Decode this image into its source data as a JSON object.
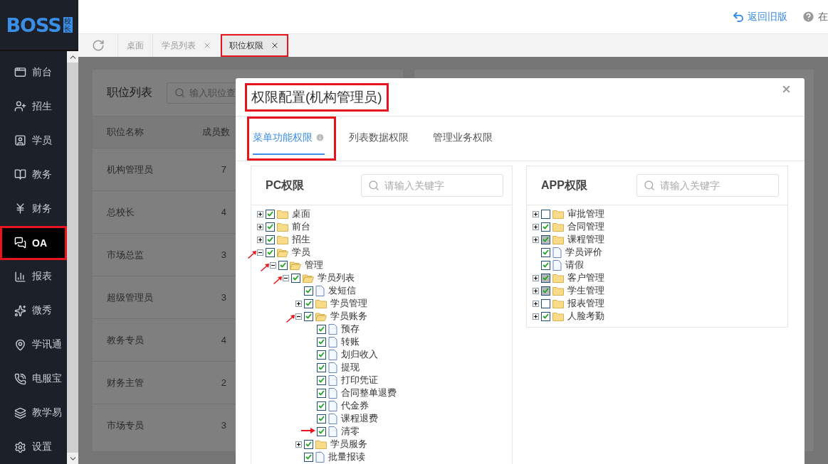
{
  "logo": {
    "text": "BOSS",
    "badge": "校长"
  },
  "header": {
    "links": [
      {
        "kind": "undo",
        "label": "返回旧版"
      },
      {
        "kind": "help",
        "label": "在"
      }
    ]
  },
  "tabs": [
    {
      "label": "桌面",
      "closable": false,
      "selected": false,
      "highlighted": false
    },
    {
      "label": "学员列表",
      "closable": true,
      "selected": false,
      "highlighted": false
    },
    {
      "label": "职位权限",
      "closable": true,
      "selected": true,
      "highlighted": true
    }
  ],
  "sidebar": {
    "items": [
      {
        "label": "前台",
        "selected": false,
        "highlighted": false
      },
      {
        "label": "招生",
        "selected": false,
        "highlighted": false
      },
      {
        "label": "学员",
        "selected": false,
        "highlighted": false
      },
      {
        "label": "教务",
        "selected": false,
        "highlighted": false
      },
      {
        "label": "财务",
        "selected": false,
        "highlighted": false
      },
      {
        "label": "OA",
        "selected": true,
        "highlighted": true
      },
      {
        "label": "报表",
        "selected": false,
        "highlighted": false
      },
      {
        "label": "微秀",
        "selected": false,
        "highlighted": false
      },
      {
        "label": "学讯通",
        "selected": false,
        "highlighted": false
      },
      {
        "label": "电服宝",
        "selected": false,
        "highlighted": false
      },
      {
        "label": "教学易",
        "selected": false,
        "highlighted": false
      },
      {
        "label": "设置",
        "selected": false,
        "highlighted": false
      }
    ]
  },
  "position_list": {
    "title": "职位列表",
    "search_placeholder": "输入职位查",
    "columns": [
      "职位名称",
      "成员数"
    ],
    "rows": [
      [
        "机构管理员",
        "7"
      ],
      [
        "总校长",
        "4"
      ],
      [
        "市场总监",
        "3"
      ],
      [
        "超级管理员",
        "3"
      ],
      [
        "教务专员",
        "4"
      ],
      [
        "财务主管",
        "2"
      ],
      [
        "市场专员",
        "3"
      ]
    ]
  },
  "modal": {
    "title": "权限配置(机构管理员)",
    "title_highlighted": true,
    "tabs": [
      {
        "label": "菜单功能权限",
        "info": true,
        "selected": true,
        "highlighted": true
      },
      {
        "label": "列表数据权限",
        "info": false,
        "selected": false,
        "highlighted": false
      },
      {
        "label": "管理业务权限",
        "info": false,
        "selected": false,
        "highlighted": false
      }
    ],
    "panels": [
      {
        "title": "PC权限",
        "placeholder": "请输入关键字",
        "tree": [
          {
            "label": "桌面",
            "kind": "folder",
            "expanded": false,
            "checked": true,
            "partial": false
          },
          {
            "label": "前台",
            "kind": "folder",
            "expanded": false,
            "checked": true,
            "partial": false
          },
          {
            "label": "招生",
            "kind": "folder",
            "expanded": false,
            "checked": true,
            "partial": false
          },
          {
            "label": "学员",
            "kind": "folder",
            "expanded": true,
            "checked": true,
            "partial": false,
            "arrow": true,
            "children": [
              {
                "label": "管理",
                "kind": "folder",
                "expanded": true,
                "checked": true,
                "partial": false,
                "arrow": true,
                "children": [
                  {
                    "label": "学员列表",
                    "kind": "folder",
                    "expanded": true,
                    "checked": true,
                    "partial": false,
                    "arrow": true,
                    "children": [
                      {
                        "label": "发短信",
                        "kind": "file",
                        "checked": true,
                        "partial": false
                      },
                      {
                        "label": "学员管理",
                        "kind": "folder",
                        "expanded": false,
                        "checked": true,
                        "partial": false
                      },
                      {
                        "label": "学员账务",
                        "kind": "folder",
                        "expanded": true,
                        "checked": true,
                        "partial": false,
                        "arrow": true,
                        "children": [
                          {
                            "label": "预存",
                            "kind": "file",
                            "checked": true,
                            "partial": false
                          },
                          {
                            "label": "转账",
                            "kind": "file",
                            "checked": true,
                            "partial": false
                          },
                          {
                            "label": "划归收入",
                            "kind": "file",
                            "checked": true,
                            "partial": false
                          },
                          {
                            "label": "提现",
                            "kind": "file",
                            "checked": true,
                            "partial": false
                          },
                          {
                            "label": "打印凭证",
                            "kind": "file",
                            "checked": true,
                            "partial": false
                          },
                          {
                            "label": "合同整单退费",
                            "kind": "file",
                            "checked": true,
                            "partial": false
                          },
                          {
                            "label": "代金券",
                            "kind": "file",
                            "checked": true,
                            "partial": false
                          },
                          {
                            "label": "课程退费",
                            "kind": "file",
                            "checked": true,
                            "partial": false
                          },
                          {
                            "label": "清零",
                            "kind": "file",
                            "checked": true,
                            "partial": false,
                            "arrow": true
                          }
                        ]
                      },
                      {
                        "label": "学员服务",
                        "kind": "folder",
                        "expanded": false,
                        "checked": true,
                        "partial": false
                      },
                      {
                        "label": "批量报读",
                        "kind": "file",
                        "checked": true,
                        "partial": false
                      }
                    ]
                  }
                ]
              }
            ]
          }
        ]
      },
      {
        "title": "APP权限",
        "placeholder": "请输入关键字",
        "tree": [
          {
            "label": "审批管理",
            "kind": "folder",
            "expanded": false,
            "checked": false,
            "partial": false
          },
          {
            "label": "合同管理",
            "kind": "folder",
            "expanded": false,
            "checked": true,
            "partial": false
          },
          {
            "label": "课程管理",
            "kind": "folder",
            "expanded": false,
            "checked": true,
            "partial": true
          },
          {
            "label": "学员评价",
            "kind": "file",
            "checked": true,
            "partial": false
          },
          {
            "label": "请假",
            "kind": "file",
            "checked": true,
            "partial": false
          },
          {
            "label": "客户管理",
            "kind": "folder",
            "expanded": false,
            "checked": true,
            "partial": true
          },
          {
            "label": "学生管理",
            "kind": "folder",
            "expanded": false,
            "checked": true,
            "partial": true
          },
          {
            "label": "报表管理",
            "kind": "folder",
            "expanded": false,
            "checked": false,
            "partial": false
          },
          {
            "label": "人脸考勤",
            "kind": "folder",
            "expanded": false,
            "checked": true,
            "partial": false
          }
        ]
      }
    ]
  }
}
